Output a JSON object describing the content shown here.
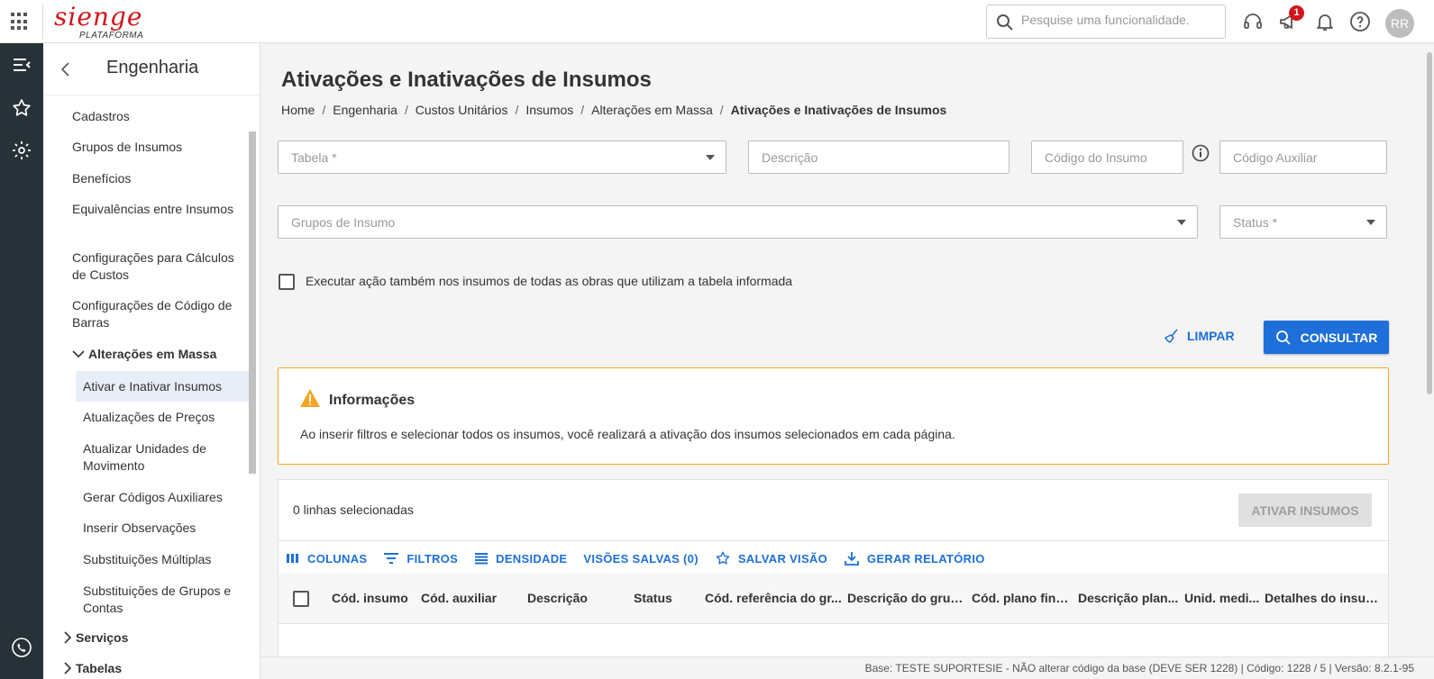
{
  "topbar": {
    "logo_text": "sienge",
    "logo_subtitle": "PLATAFORMA",
    "search_placeholder": "Pesquise uma funcionalidade.",
    "notification_count": "1",
    "avatar_initials": "RR"
  },
  "sidebar": {
    "title": "Engenharia",
    "items": [
      {
        "label": "Cadastros"
      },
      {
        "label": "Grupos de Insumos"
      },
      {
        "label": "Benefícios"
      },
      {
        "label": "Equivalências entre Insumos"
      },
      {
        "label": "Configurações para Cálculos de Custos"
      },
      {
        "label": "Configurações de Código de Barras"
      }
    ],
    "group": {
      "label": "Alterações em Massa",
      "children": [
        {
          "label": "Ativar e Inativar Insumos",
          "active": true
        },
        {
          "label": "Atualizações de Preços"
        },
        {
          "label": "Atualizar Unidades de Movimento"
        },
        {
          "label": "Gerar Códigos Auxiliares"
        },
        {
          "label": "Inserir Observações"
        },
        {
          "label": "Substituições Múltiplas"
        },
        {
          "label": "Substituições de Grupos e Contas"
        }
      ]
    },
    "group2": {
      "label": "Serviços"
    },
    "group3": {
      "label": "Tabelas"
    }
  },
  "main": {
    "title": "Ativações e Inativações de Insumos",
    "breadcrumb": [
      "Home",
      "Engenharia",
      "Custos Unitários",
      "Insumos",
      "Alterações em Massa",
      "Ativações e Inativações de Insumos"
    ],
    "fields": {
      "tabela": "Tabela *",
      "descricao": "Descrição",
      "codigo_insumo": "Código do Insumo",
      "codigo_auxiliar": "Código Auxiliar",
      "grupos_insumo": "Grupos de Insumo",
      "status": "Status *"
    },
    "checkbox_label": "Executar ação também nos insumos de todas as obras que utilizam a tabela informada",
    "btn_limpar": "LIMPAR",
    "btn_consultar": "CONSULTAR",
    "alert": {
      "title": "Informações",
      "text": "Ao inserir filtros e selecionar todos os insumos, você realizará a ativação dos insumos selecionados em cada página."
    },
    "table": {
      "selected_text": "0 linhas selecionadas",
      "btn_ativar": "ATIVAR INSUMOS",
      "toolbar": {
        "colunas": "COLUNAS",
        "filtros": "FILTROS",
        "densidade": "DENSIDADE",
        "visoes": "VISÕES SALVAS (0)",
        "salvar": "SALVAR VISÃO",
        "relatorio": "GERAR RELATÓRIO"
      },
      "columns": [
        "Cód. insumo",
        "Cód. auxiliar",
        "Descrição",
        "Status",
        "Cód. referência do gr...",
        "Descrição do grup...",
        "Cód. plano fina...",
        "Descrição plan...",
        "Unid. medi...",
        "Detalhes do insumo"
      ]
    }
  },
  "statusbar": {
    "text": "Base: TESTE SUPORTESIE - NÃO alterar código da base (DEVE SER 1228) | Código: 1228 / 5 | Versão: 8.2.1-95"
  },
  "colors": {
    "brand": "#d0151b",
    "accent": "#1e6fd9",
    "alert_border": "#f5a623",
    "rail": "#263238"
  }
}
